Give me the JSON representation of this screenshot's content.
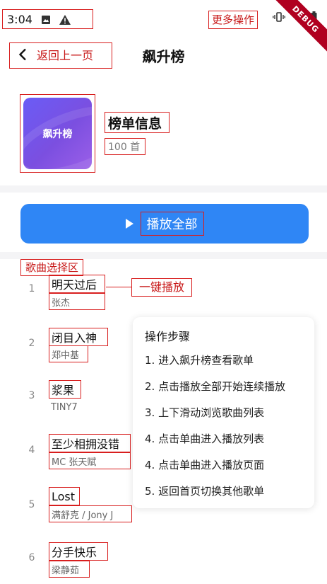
{
  "status_bar": {
    "time": "3:04",
    "icons": [
      "image-icon",
      "warning-icon",
      "vibrate-icon",
      "wifi-icon",
      "battery-icon"
    ]
  },
  "annotations": {
    "more_actions": "更多操作",
    "back": "返回上一页",
    "section": "歌曲选择区",
    "one_key_play": "一键播放"
  },
  "debug_banner": "DEBUG",
  "app_bar": {
    "title": "飙升榜"
  },
  "playlist": {
    "cover_text": "飙升榜",
    "info_title": "榜单信息",
    "count": "100 首"
  },
  "play_all": {
    "label": "播放全部"
  },
  "songs": [
    {
      "index": "1",
      "name": "明天过后",
      "artist": "张杰"
    },
    {
      "index": "2",
      "name": "闭目入神",
      "artist": "郑中基"
    },
    {
      "index": "3",
      "name": "浆果",
      "artist": "TINY7"
    },
    {
      "index": "4",
      "name": "至少相拥没错",
      "artist": "MC 张天赋"
    },
    {
      "index": "5",
      "name": "Lost",
      "artist": "满舒克 / Jony J"
    },
    {
      "index": "6",
      "name": "分手快乐",
      "artist": "梁静茹"
    }
  ],
  "steps": {
    "title": "操作步骤",
    "items": [
      "1. 进入飙升榜查看歌单",
      "2. 点击播放全部开始连续播放",
      "3. 上下滑动浏览歌曲列表",
      "4. 点击单曲进入播放列表",
      "4. 点击单曲进入播放页面",
      "5. 返回首页切换其他歌单"
    ]
  },
  "colors": {
    "accent": "#2f86f5",
    "annotation": "#d81e1e",
    "cover_gradient_start": "#6a5cf6",
    "cover_gradient_end": "#9b5fe8"
  }
}
